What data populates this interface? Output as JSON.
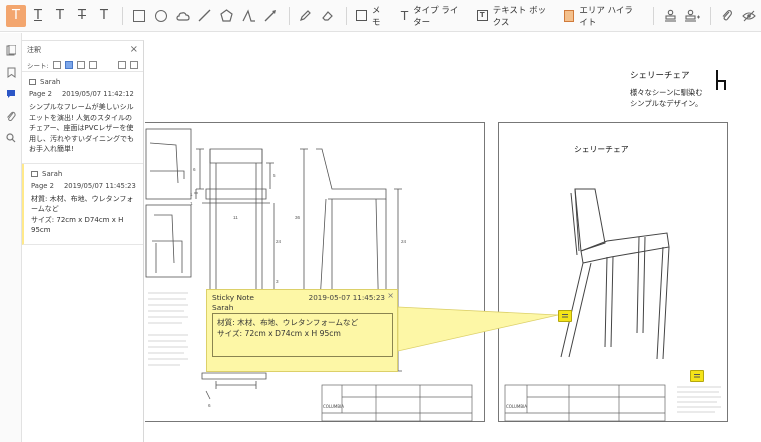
{
  "toolbar": {
    "memo_label": "メモ",
    "typewriter_label": "タイプ ライター",
    "textbox_label": "テキスト ボックス",
    "area_highlight_label": "エリア ハイライト",
    "textbox_glyph": "T"
  },
  "panel": {
    "title": "注釈",
    "close_glyph": "×",
    "sheet_label": "シート:",
    "comments": [
      {
        "author": "Sarah",
        "page": "Page 2",
        "datetime": "2019/05/07 11:42:12",
        "text": "シンプルなフレームが美しいシルエットを演出! 人気のスタイルのチェアー、座面はPVCレザーを使用し、汚れやすいダイニングでもお手入れ簡単!"
      },
      {
        "author": "Sarah",
        "page": "Page 2",
        "datetime": "2019/05/07 11:45:23",
        "text": "材質: 木材、布地、ウレタンフォームなど\nサイズ: 72cm x D74cm x H 95cm"
      }
    ]
  },
  "document": {
    "product_title": "シェリーチェア",
    "product_desc_line1": "様々なシーンに馴染む",
    "product_desc_line2": "シンプルなデザイン。",
    "right_sheet_title": "シェリーチェア",
    "brand": "COLUMBIA"
  },
  "sticky_note": {
    "title": "Sticky Note",
    "author": "Sarah",
    "datetime": "2019-05-07 11:45:23",
    "close_glyph": "×",
    "line1": "材質: 木材、布地、ウレタンフォームなど",
    "line2": "サイズ: 72cm x D74cm x H 95cm"
  },
  "dimensions": {
    "d6": "6",
    "d5": "5",
    "d3": "3",
    "d1a": "1",
    "d1b": "1",
    "d11": "11",
    "d36": "36",
    "d24a": "24",
    "d24b": "24",
    "d6b": "6"
  },
  "colors": {
    "active_tool": "#f3a66f",
    "sticky_bg": "#fdf7a6",
    "pin": "#f4e419",
    "selected_nav": "#2b56c6"
  }
}
